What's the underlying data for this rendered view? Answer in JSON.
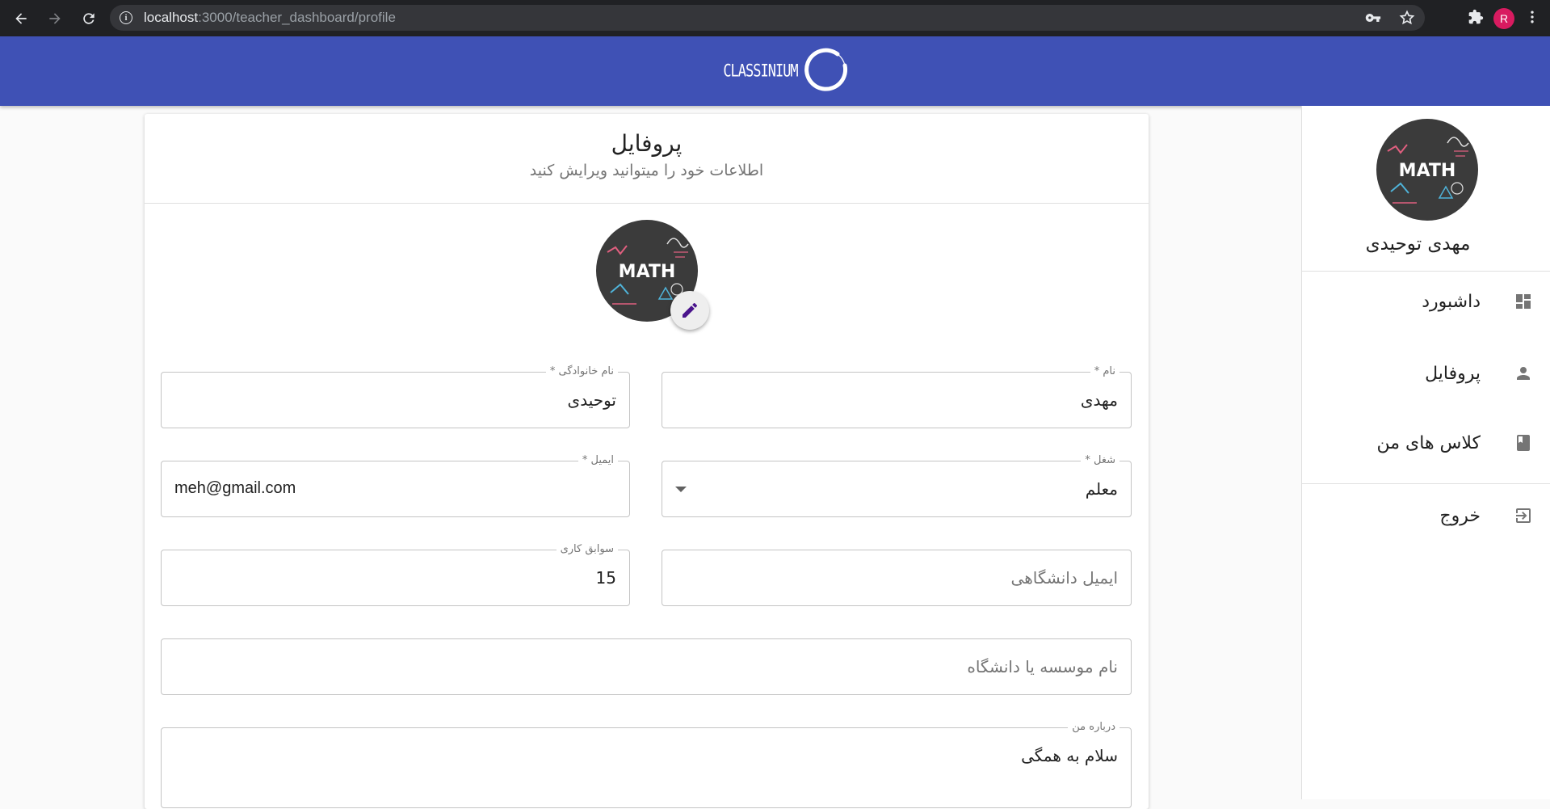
{
  "browser": {
    "url_host": "localhost",
    "url_path": ":3000/teacher_dashboard/profile",
    "profile_initial": "R"
  },
  "app": {
    "logo_text": "CLASSINIUM",
    "brand_color": "#3f51b5"
  },
  "sidebar": {
    "user_name": "مهدی توحیدی",
    "items": [
      {
        "label": "داشبورد",
        "icon": "dashboard-icon"
      },
      {
        "label": "پروفایل",
        "icon": "person-icon"
      },
      {
        "label": "کلاس های من",
        "icon": "book-icon"
      },
      {
        "label": "خروج",
        "icon": "logout-icon"
      }
    ]
  },
  "photo": {
    "text": "MATH"
  },
  "card": {
    "title": "پروفایل",
    "subtitle": "اطلاعات خود را میتوانید ویرایش کنید"
  },
  "form": {
    "first_name": {
      "label": "نام *",
      "value": "مهدی"
    },
    "last_name": {
      "label": "نام خانوادگی *",
      "value": "توحیدی"
    },
    "job": {
      "label": "شغل *",
      "value": "معلم"
    },
    "email": {
      "label": "ایمیل *",
      "value": "meh@gmail.com"
    },
    "university_email": {
      "placeholder": "ایمیل دانشگاهی"
    },
    "experience": {
      "label": "سوابق کاری",
      "value": "15"
    },
    "institution": {
      "placeholder": "نام موسسه یا دانشگاه"
    },
    "about": {
      "label": "درباره من",
      "value": "سلام به همگی"
    }
  }
}
